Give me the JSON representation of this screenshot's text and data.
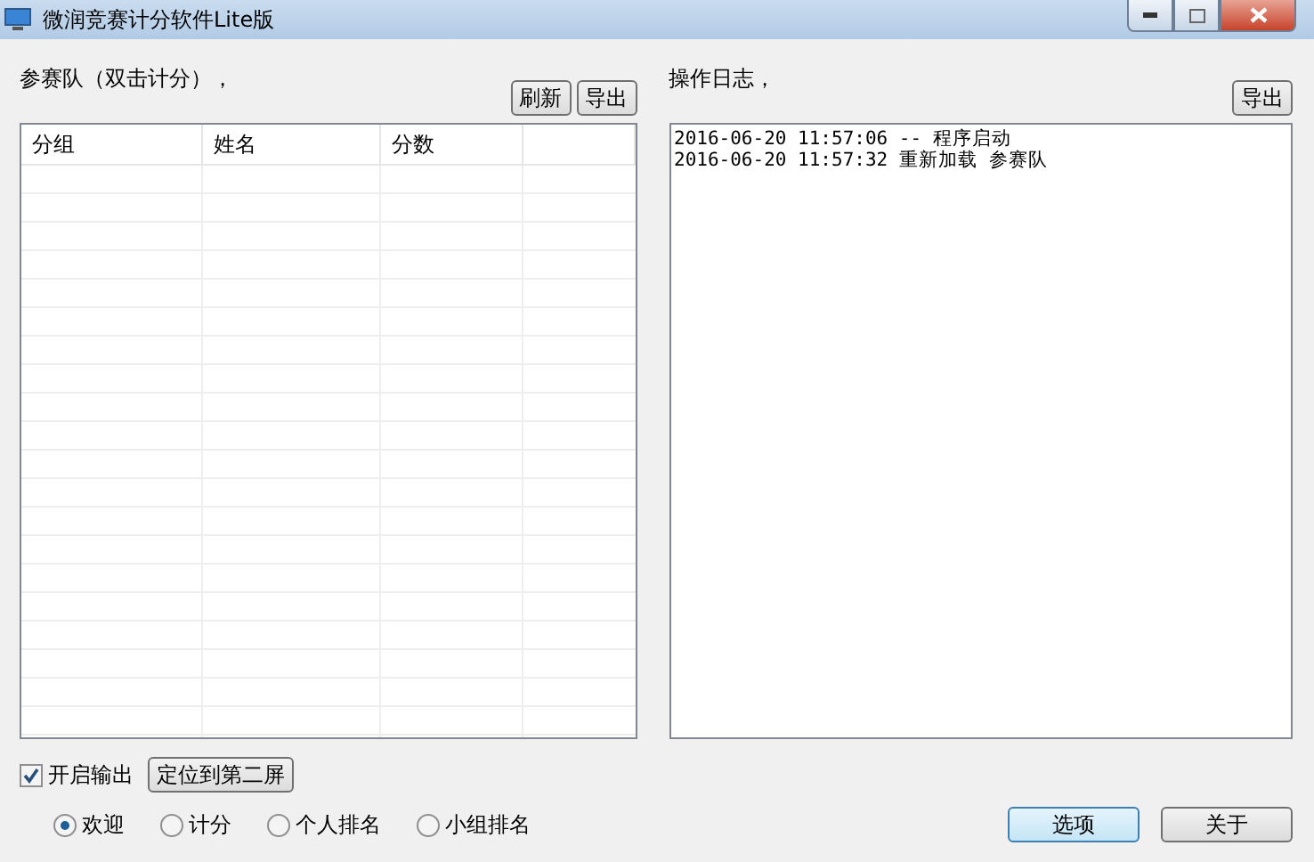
{
  "window": {
    "title": "微润竞赛计分软件Lite版"
  },
  "teams": {
    "label": "参赛队（双击计分），",
    "buttons": [
      "刷新",
      "导出"
    ],
    "columns": [
      "分组",
      "姓名",
      "分数"
    ]
  },
  "log": {
    "label": "操作日志，",
    "buttons": [
      "导出"
    ],
    "lines": [
      "2016-06-20 11:57:06 -- 程序启动",
      "2016-06-20 11:57:32 重新加载 参赛队"
    ]
  },
  "output": {
    "label": "开启输出",
    "checked": true,
    "button": "定位到第二屏"
  },
  "modes": [
    {
      "label": "欢迎",
      "selected": true
    },
    {
      "label": "计分",
      "selected": false
    },
    {
      "label": "个人排名",
      "selected": false
    },
    {
      "label": "小组排名",
      "selected": false
    }
  ],
  "actions": [
    {
      "label": "选项",
      "focused": true
    },
    {
      "label": "关于",
      "focused": false
    }
  ]
}
